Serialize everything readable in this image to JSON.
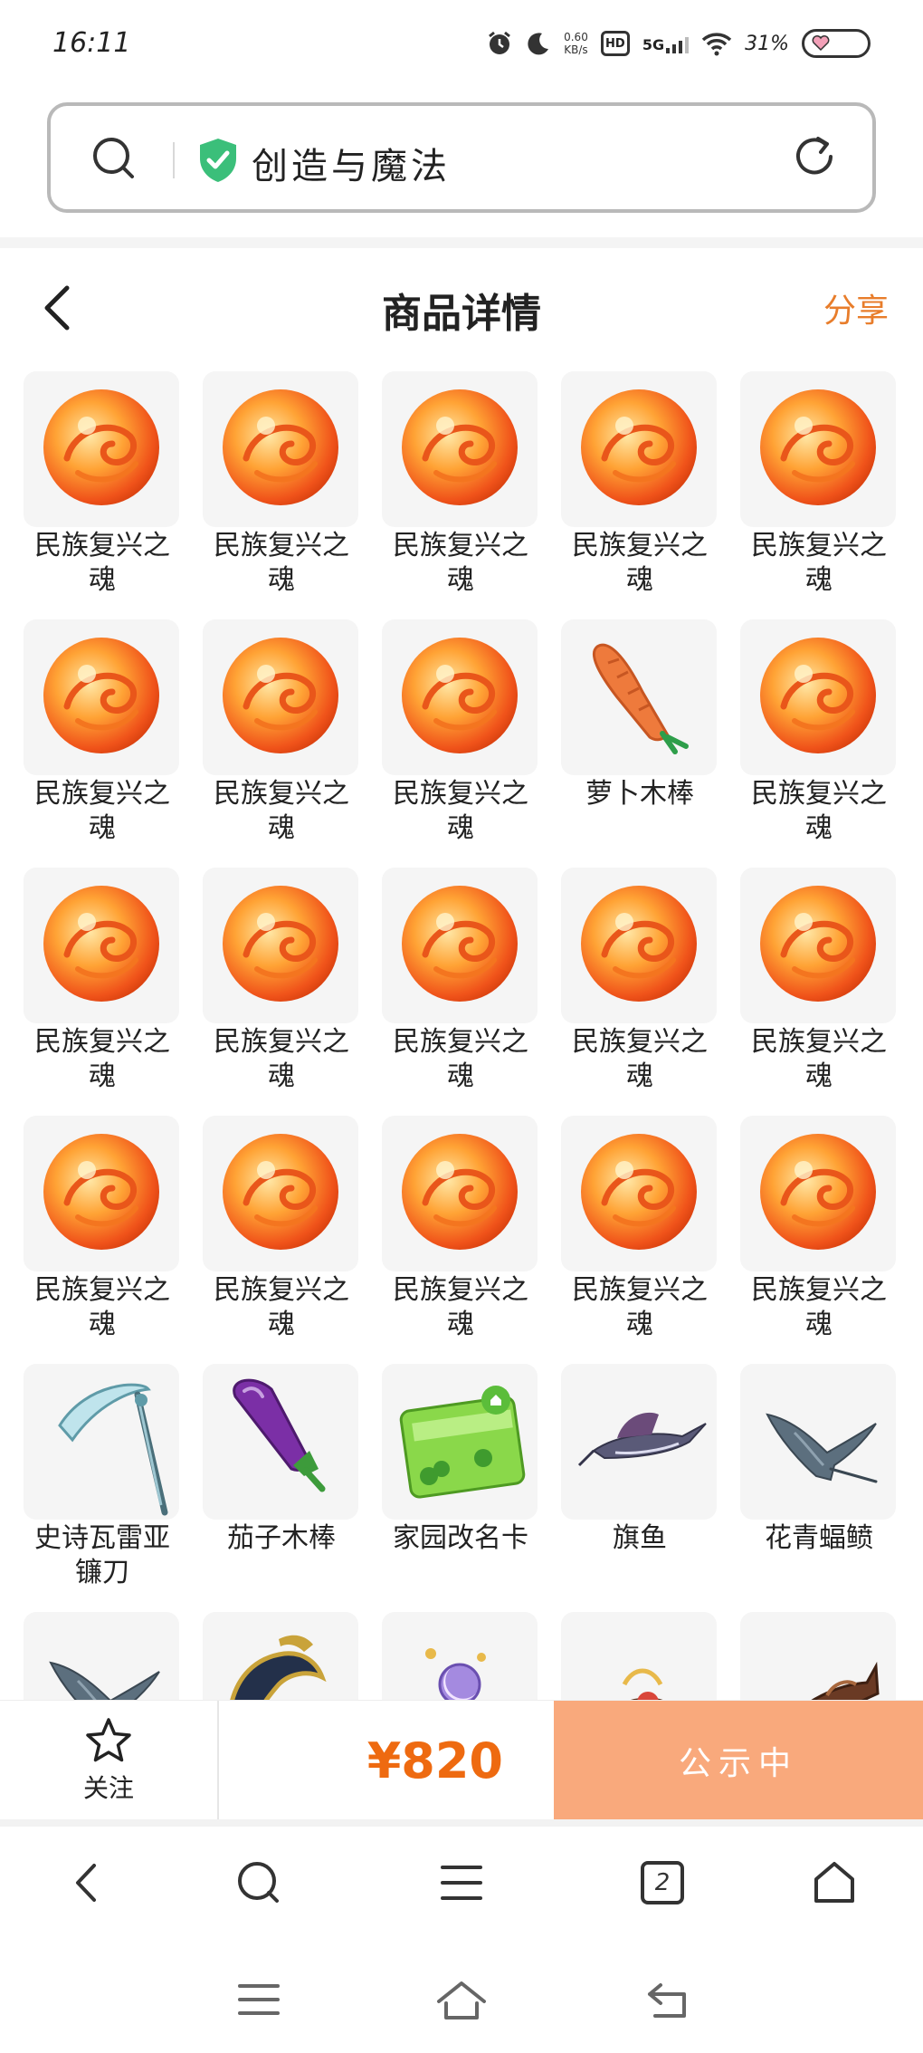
{
  "status": {
    "time": "16:11",
    "net_speed_value": "0.60",
    "net_speed_unit": "KB/s",
    "hd": "HD",
    "network": "5G",
    "battery": "31%"
  },
  "address_bar": {
    "site_name": "创造与魔法"
  },
  "header": {
    "title": "商品详情",
    "share": "分享"
  },
  "items": [
    {
      "label": "民族复兴之魂",
      "icon": "dragon-orb"
    },
    {
      "label": "民族复兴之魂",
      "icon": "dragon-orb"
    },
    {
      "label": "民族复兴之魂",
      "icon": "dragon-orb"
    },
    {
      "label": "民族复兴之魂",
      "icon": "dragon-orb"
    },
    {
      "label": "民族复兴之魂",
      "icon": "dragon-orb"
    },
    {
      "label": "民族复兴之魂",
      "icon": "dragon-orb"
    },
    {
      "label": "民族复兴之魂",
      "icon": "dragon-orb"
    },
    {
      "label": "民族复兴之魂",
      "icon": "dragon-orb"
    },
    {
      "label": "萝卜木棒",
      "icon": "carrot-wand"
    },
    {
      "label": "民族复兴之魂",
      "icon": "dragon-orb"
    },
    {
      "label": "民族复兴之魂",
      "icon": "dragon-orb"
    },
    {
      "label": "民族复兴之魂",
      "icon": "dragon-orb"
    },
    {
      "label": "民族复兴之魂",
      "icon": "dragon-orb"
    },
    {
      "label": "民族复兴之魂",
      "icon": "dragon-orb"
    },
    {
      "label": "民族复兴之魂",
      "icon": "dragon-orb"
    },
    {
      "label": "民族复兴之魂",
      "icon": "dragon-orb"
    },
    {
      "label": "民族复兴之魂",
      "icon": "dragon-orb"
    },
    {
      "label": "民族复兴之魂",
      "icon": "dragon-orb"
    },
    {
      "label": "民族复兴之魂",
      "icon": "dragon-orb"
    },
    {
      "label": "民族复兴之魂",
      "icon": "dragon-orb"
    },
    {
      "label": "史诗瓦雷亚镰刀",
      "icon": "scythe"
    },
    {
      "label": "茄子木棒",
      "icon": "eggplant-wand"
    },
    {
      "label": "家园改名卡",
      "icon": "rename-card"
    },
    {
      "label": "旗鱼",
      "icon": "sailfish"
    },
    {
      "label": "花青蝠鲼",
      "icon": "manta-ray"
    },
    {
      "label": "",
      "icon": "manta-ray"
    },
    {
      "label": "",
      "icon": "dark-armor"
    },
    {
      "label": "",
      "icon": "moon-staff"
    },
    {
      "label": "",
      "icon": "treasure-pile"
    },
    {
      "label": "",
      "icon": "brown-fish"
    }
  ],
  "action_bar": {
    "follow_label": "关注",
    "price": "¥820",
    "status_button": "公示中"
  },
  "browser_nav": {
    "tabs_count": "2"
  },
  "colors": {
    "accent_orange": "#e87d2b",
    "price_orange": "#ee6a10",
    "status_button_bg": "#f9a97c",
    "shield_green": "#3bbf7a"
  }
}
